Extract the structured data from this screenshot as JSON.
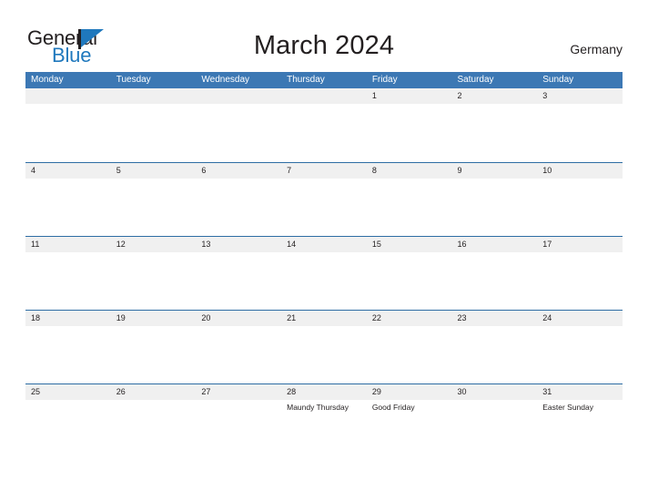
{
  "header": {
    "logo": {
      "text_primary": "General",
      "text_secondary": "Blue",
      "icon": "flag-triangle-icon",
      "color_primary": "#231f20",
      "color_secondary": "#1f78bd"
    },
    "title": "March 2024",
    "region": "Germany"
  },
  "calendar": {
    "month": "March",
    "year": "2024",
    "accent_color": "#3c78b4",
    "band_color": "#f0f0f0",
    "rule_color": "#2e6da4",
    "weekdays": [
      "Monday",
      "Tuesday",
      "Wednesday",
      "Thursday",
      "Friday",
      "Saturday",
      "Sunday"
    ],
    "weeks": [
      [
        {
          "day": "",
          "events": []
        },
        {
          "day": "",
          "events": []
        },
        {
          "day": "",
          "events": []
        },
        {
          "day": "",
          "events": []
        },
        {
          "day": "1",
          "events": []
        },
        {
          "day": "2",
          "events": []
        },
        {
          "day": "3",
          "events": []
        }
      ],
      [
        {
          "day": "4",
          "events": []
        },
        {
          "day": "5",
          "events": []
        },
        {
          "day": "6",
          "events": []
        },
        {
          "day": "7",
          "events": []
        },
        {
          "day": "8",
          "events": []
        },
        {
          "day": "9",
          "events": []
        },
        {
          "day": "10",
          "events": []
        }
      ],
      [
        {
          "day": "11",
          "events": []
        },
        {
          "day": "12",
          "events": []
        },
        {
          "day": "13",
          "events": []
        },
        {
          "day": "14",
          "events": []
        },
        {
          "day": "15",
          "events": []
        },
        {
          "day": "16",
          "events": []
        },
        {
          "day": "17",
          "events": []
        }
      ],
      [
        {
          "day": "18",
          "events": []
        },
        {
          "day": "19",
          "events": []
        },
        {
          "day": "20",
          "events": []
        },
        {
          "day": "21",
          "events": []
        },
        {
          "day": "22",
          "events": []
        },
        {
          "day": "23",
          "events": []
        },
        {
          "day": "24",
          "events": []
        }
      ],
      [
        {
          "day": "25",
          "events": []
        },
        {
          "day": "26",
          "events": []
        },
        {
          "day": "27",
          "events": []
        },
        {
          "day": "28",
          "events": [
            "Maundy Thursday"
          ]
        },
        {
          "day": "29",
          "events": [
            "Good Friday"
          ]
        },
        {
          "day": "30",
          "events": []
        },
        {
          "day": "31",
          "events": [
            "Easter Sunday"
          ]
        }
      ]
    ]
  }
}
